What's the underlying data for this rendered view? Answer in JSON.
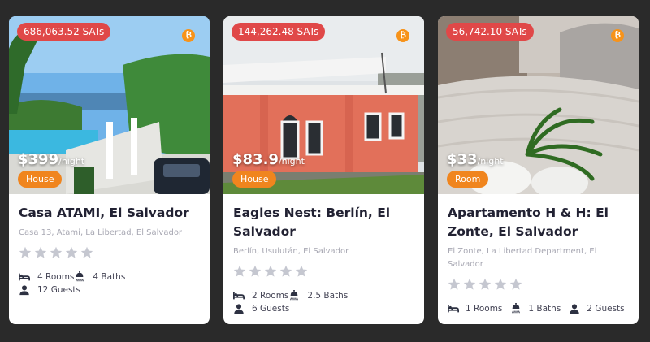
{
  "currency_icon": "bitcoin-icon",
  "colors": {
    "sats_badge": "#e04848",
    "type_badge": "#f0851e",
    "bitcoin": "#f7931a"
  },
  "listings": [
    {
      "sats": "686,063.52 SATs",
      "price": "$399",
      "per": "/night",
      "type": "House",
      "title": "Casa ATAMI, El Salvador",
      "address": "Casa 13, Atami, La Libertad, El Salvador",
      "rating": 0,
      "rooms": "4 Rooms",
      "baths": "4 Baths",
      "guests": "12 Guests"
    },
    {
      "sats": "144,262.48 SATs",
      "price": "$83.9",
      "per": "/night",
      "type": "House",
      "title": "Eagles Nest: Berlín, El Salvador",
      "address": "Berlín, Usulután, El Salvador",
      "rating": 0,
      "rooms": "2 Rooms",
      "baths": "2.5 Baths",
      "guests": "6 Guests"
    },
    {
      "sats": "56,742.10 SATs",
      "price": "$33",
      "per": "/night",
      "type": "Room",
      "title": "Apartamento H & H: El Zonte, El Salvador",
      "address": "El Zonte, La Libertad Department, El Salvador",
      "rating": 0,
      "rooms": "1 Rooms",
      "baths": "1 Baths",
      "guests": "2 Guests"
    }
  ]
}
